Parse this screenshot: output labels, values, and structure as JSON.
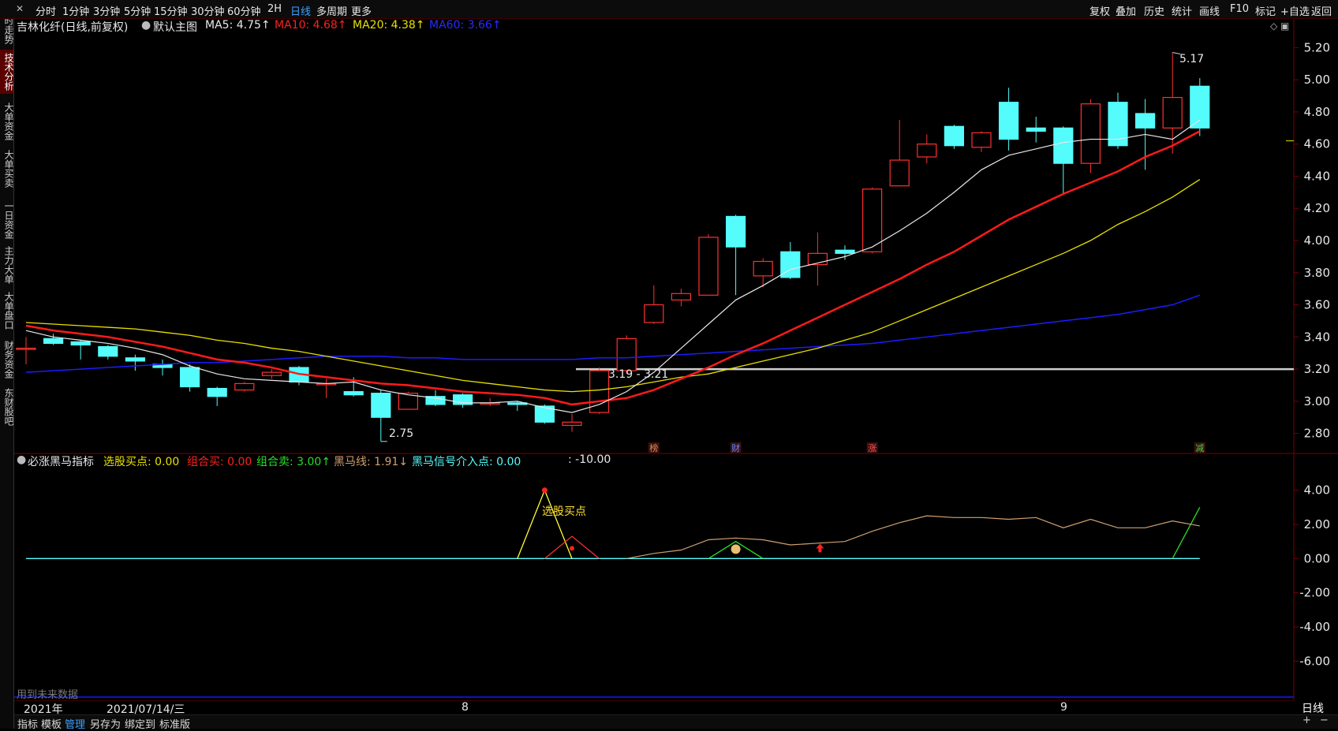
{
  "toolbar": {
    "periods": [
      "分时",
      "1分钟",
      "3分钟",
      "5分钟",
      "15分钟",
      "30分钟",
      "60分钟",
      "2H",
      "日线",
      "多周期",
      "更多"
    ],
    "active_period": "日线",
    "right_tools": [
      "复权",
      "叠加",
      "历史",
      "统计",
      "画线",
      "F10",
      "标记",
      "+自选",
      "返回"
    ]
  },
  "left_tabs": [
    "分时走势",
    "技术分析",
    "大单资金",
    "大单买卖",
    "一日资金",
    "主力大单",
    "大单盘口",
    "财务资金",
    "东财股吧"
  ],
  "left_tab_active": "技术分析",
  "main_header": {
    "stock": "吉林化纤(日线,前复权)",
    "template": "默认主图",
    "ma5": "MA5: 4.75↑",
    "ma10": "MA10: 4.68↑",
    "ma20": "MA20: 4.38↑",
    "ma60": "MA60: 3.66↑"
  },
  "colors": {
    "up": "#ff3030",
    "down": "#54fcfc",
    "ma5": "#e8e8e8",
    "ma10": "#ff1a1a",
    "ma20": "#e8e000",
    "ma60": "#1c1cff",
    "grid_border": "#7a0000",
    "indicator_line": "#d0a070",
    "select_point": "#ffff30"
  },
  "price_axis": [
    "5.20",
    "5.00",
    "4.80",
    "4.60",
    "4.40",
    "4.20",
    "4.00",
    "3.80",
    "3.60",
    "3.40",
    "3.20",
    "3.00",
    "2.80"
  ],
  "annotations": {
    "high": "5.17",
    "low": "2.75",
    "range": "3.19 - 3.21"
  },
  "markers": [
    "榜",
    "财",
    "涨",
    "减"
  ],
  "chart_data": {
    "type": "candlestick",
    "ylim": [
      2.7,
      5.3
    ],
    "candles": [
      {
        "o": 3.33,
        "c": 3.33,
        "h": 3.4,
        "l": 3.23
      },
      {
        "o": 3.39,
        "c": 3.36,
        "h": 3.42,
        "l": 3.35
      },
      {
        "o": 3.37,
        "c": 3.35,
        "h": 3.38,
        "l": 3.26
      },
      {
        "o": 3.34,
        "c": 3.28,
        "h": 3.35,
        "l": 3.26
      },
      {
        "o": 3.27,
        "c": 3.25,
        "h": 3.29,
        "l": 3.19
      },
      {
        "o": 3.23,
        "c": 3.21,
        "h": 3.26,
        "l": 3.16
      },
      {
        "o": 3.21,
        "c": 3.09,
        "h": 3.23,
        "l": 3.06
      },
      {
        "o": 3.08,
        "c": 3.03,
        "h": 3.09,
        "l": 2.97
      },
      {
        "o": 3.07,
        "c": 3.11,
        "h": 3.12,
        "l": 3.06
      },
      {
        "o": 3.16,
        "c": 3.18,
        "h": 3.2,
        "l": 3.14
      },
      {
        "o": 3.21,
        "c": 3.12,
        "h": 3.22,
        "l": 3.1
      },
      {
        "o": 3.11,
        "c": 3.11,
        "h": 3.14,
        "l": 3.02
      },
      {
        "o": 3.06,
        "c": 3.04,
        "h": 3.15,
        "l": 3.03
      },
      {
        "o": 3.05,
        "c": 2.9,
        "h": 3.07,
        "l": 2.75
      },
      {
        "o": 2.95,
        "c": 3.05,
        "h": 3.06,
        "l": 2.95
      },
      {
        "o": 3.03,
        "c": 2.98,
        "h": 3.07,
        "l": 2.97
      },
      {
        "o": 3.04,
        "c": 2.98,
        "h": 3.05,
        "l": 2.96
      },
      {
        "o": 2.99,
        "c": 2.99,
        "h": 3.02,
        "l": 2.97
      },
      {
        "o": 2.99,
        "c": 2.98,
        "h": 3.0,
        "l": 2.94
      },
      {
        "o": 2.97,
        "c": 2.87,
        "h": 2.98,
        "l": 2.86
      },
      {
        "o": 2.85,
        "c": 2.87,
        "h": 2.92,
        "l": 2.81
      },
      {
        "o": 2.93,
        "c": 3.19,
        "h": 3.21,
        "l": 2.92
      },
      {
        "o": 3.19,
        "c": 3.39,
        "h": 3.41,
        "l": 3.17
      },
      {
        "o": 3.49,
        "c": 3.6,
        "h": 3.72,
        "l": 3.48
      },
      {
        "o": 3.63,
        "c": 3.67,
        "h": 3.7,
        "l": 3.59
      },
      {
        "o": 3.66,
        "c": 4.02,
        "h": 4.04,
        "l": 3.66
      },
      {
        "o": 4.15,
        "c": 3.96,
        "h": 4.16,
        "l": 3.66
      },
      {
        "o": 3.78,
        "c": 3.87,
        "h": 3.89,
        "l": 3.71
      },
      {
        "o": 3.93,
        "c": 3.77,
        "h": 3.99,
        "l": 3.76
      },
      {
        "o": 3.85,
        "c": 3.92,
        "h": 4.05,
        "l": 3.72
      },
      {
        "o": 3.94,
        "c": 3.92,
        "h": 3.97,
        "l": 3.88
      },
      {
        "o": 3.93,
        "c": 4.32,
        "h": 4.33,
        "l": 3.92
      },
      {
        "o": 4.34,
        "c": 4.5,
        "h": 4.75,
        "l": 4.34
      },
      {
        "o": 4.52,
        "c": 4.6,
        "h": 4.66,
        "l": 4.48
      },
      {
        "o": 4.71,
        "c": 4.59,
        "h": 4.72,
        "l": 4.57
      },
      {
        "o": 4.58,
        "c": 4.67,
        "h": 4.68,
        "l": 4.55
      },
      {
        "o": 4.86,
        "c": 4.63,
        "h": 4.95,
        "l": 4.56
      },
      {
        "o": 4.7,
        "c": 4.68,
        "h": 4.77,
        "l": 4.61
      },
      {
        "o": 4.7,
        "c": 4.48,
        "h": 4.71,
        "l": 4.29
      },
      {
        "o": 4.48,
        "c": 4.85,
        "h": 4.88,
        "l": 4.42
      },
      {
        "o": 4.86,
        "c": 4.59,
        "h": 4.92,
        "l": 4.57
      },
      {
        "o": 4.79,
        "c": 4.7,
        "h": 4.88,
        "l": 4.44
      },
      {
        "o": 4.7,
        "c": 4.89,
        "h": 5.17,
        "l": 4.54
      },
      {
        "o": 4.96,
        "c": 4.7,
        "h": 5.01,
        "l": 4.65
      }
    ],
    "ma5": [
      3.44,
      3.4,
      3.38,
      3.36,
      3.33,
      3.29,
      3.22,
      3.17,
      3.14,
      3.13,
      3.12,
      3.11,
      3.12,
      3.07,
      3.04,
      3.02,
      2.99,
      2.99,
      3.0,
      2.96,
      2.93,
      2.98,
      3.06,
      3.18,
      3.33,
      3.48,
      3.63,
      3.72,
      3.82,
      3.86,
      3.9,
      3.96,
      4.06,
      4.17,
      4.3,
      4.44,
      4.53,
      4.57,
      4.61,
      4.63,
      4.63,
      4.66,
      4.63,
      4.75
    ],
    "ma10": [
      3.47,
      3.44,
      3.42,
      3.4,
      3.37,
      3.34,
      3.3,
      3.26,
      3.24,
      3.21,
      3.17,
      3.15,
      3.13,
      3.11,
      3.1,
      3.08,
      3.06,
      3.05,
      3.04,
      3.02,
      2.98,
      3.0,
      3.02,
      3.07,
      3.14,
      3.21,
      3.29,
      3.36,
      3.44,
      3.52,
      3.6,
      3.68,
      3.76,
      3.85,
      3.93,
      4.03,
      4.13,
      4.21,
      4.29,
      4.36,
      4.43,
      4.52,
      4.59,
      4.68
    ],
    "ma20": [
      3.49,
      3.48,
      3.47,
      3.46,
      3.45,
      3.43,
      3.41,
      3.38,
      3.36,
      3.33,
      3.31,
      3.28,
      3.25,
      3.22,
      3.19,
      3.16,
      3.13,
      3.11,
      3.09,
      3.07,
      3.06,
      3.07,
      3.09,
      3.12,
      3.15,
      3.17,
      3.21,
      3.25,
      3.29,
      3.33,
      3.38,
      3.43,
      3.5,
      3.57,
      3.64,
      3.71,
      3.78,
      3.85,
      3.92,
      4.0,
      4.1,
      4.18,
      4.27,
      4.38
    ],
    "ma60": [
      3.18,
      3.19,
      3.2,
      3.21,
      3.22,
      3.23,
      3.24,
      3.24,
      3.25,
      3.26,
      3.27,
      3.28,
      3.28,
      3.28,
      3.27,
      3.27,
      3.26,
      3.26,
      3.26,
      3.26,
      3.26,
      3.27,
      3.27,
      3.28,
      3.29,
      3.3,
      3.31,
      3.32,
      3.33,
      3.34,
      3.35,
      3.36,
      3.38,
      3.4,
      3.42,
      3.44,
      3.46,
      3.48,
      3.5,
      3.52,
      3.54,
      3.57,
      3.6,
      3.66
    ]
  },
  "indicator": {
    "name": "必涨黑马指标",
    "select_buy": "选股买点: 0.00",
    "combo_buy": "组合买: 0.00",
    "combo_sell": "组合卖: 3.00↑",
    "horse_line": "黑马线: 1.91↓",
    "horse_signal": "黑马信号介入点: 0.00",
    "extra": ": -10.00",
    "axis": [
      "4.00",
      "2.00",
      "0.00",
      "-2.00",
      "-4.00",
      "-6.00"
    ],
    "select_label": "选股买点",
    "future_note": "用到未来数据",
    "ylim": [
      -7,
      5
    ],
    "select_buy_series": [
      0,
      0,
      0,
      0,
      0,
      0,
      0,
      0,
      0,
      0,
      0,
      0,
      0,
      0,
      0,
      0,
      0,
      0,
      0,
      4,
      0,
      0,
      0,
      0,
      0,
      0,
      0,
      0,
      0,
      0,
      0,
      0,
      0,
      0,
      0,
      0,
      0,
      0,
      0,
      0,
      0,
      0,
      0,
      0
    ],
    "combo_buy_series": [
      0,
      0,
      0,
      0,
      0,
      0,
      0,
      0,
      0,
      0,
      0,
      0,
      0,
      0,
      0,
      0,
      0,
      0,
      0,
      0,
      1.3,
      0,
      0,
      0,
      0,
      0,
      0,
      0,
      0,
      0,
      0,
      0,
      0,
      0,
      0,
      0,
      0,
      0,
      0,
      0,
      0,
      0,
      0,
      0
    ],
    "combo_sell_series": [
      0,
      0,
      0,
      0,
      0,
      0,
      0,
      0,
      0,
      0,
      0,
      0,
      0,
      0,
      0,
      0,
      0,
      0,
      0,
      0,
      0,
      0,
      0,
      0,
      0,
      0,
      1.0,
      0,
      0,
      0,
      0,
      0,
      0,
      0,
      0,
      0,
      0,
      0,
      0,
      0,
      0,
      0,
      0,
      3.0
    ],
    "horse_series": [
      0,
      0,
      0,
      0,
      0,
      0,
      0,
      0,
      0,
      0,
      0,
      0,
      0,
      0,
      0,
      0,
      0,
      0,
      0,
      0,
      0,
      0,
      0,
      0.3,
      0.5,
      1.1,
      1.2,
      1.1,
      0.8,
      0.9,
      1.0,
      1.6,
      2.1,
      2.5,
      2.4,
      2.4,
      2.3,
      2.4,
      1.8,
      2.3,
      1.8,
      1.8,
      2.2,
      1.91
    ],
    "horse_up_point": 29
  },
  "time_axis": {
    "year": "2021年",
    "date": "2021/07/14/三",
    "m8": "8",
    "m9": "9"
  },
  "period_label": "日线",
  "bottom_tabs": [
    "指标",
    "模板",
    "管理",
    "另存为",
    "绑定到",
    "标准版"
  ],
  "bottom_active": "管理",
  "zoom": {
    "plus": "+",
    "minus": "−"
  }
}
